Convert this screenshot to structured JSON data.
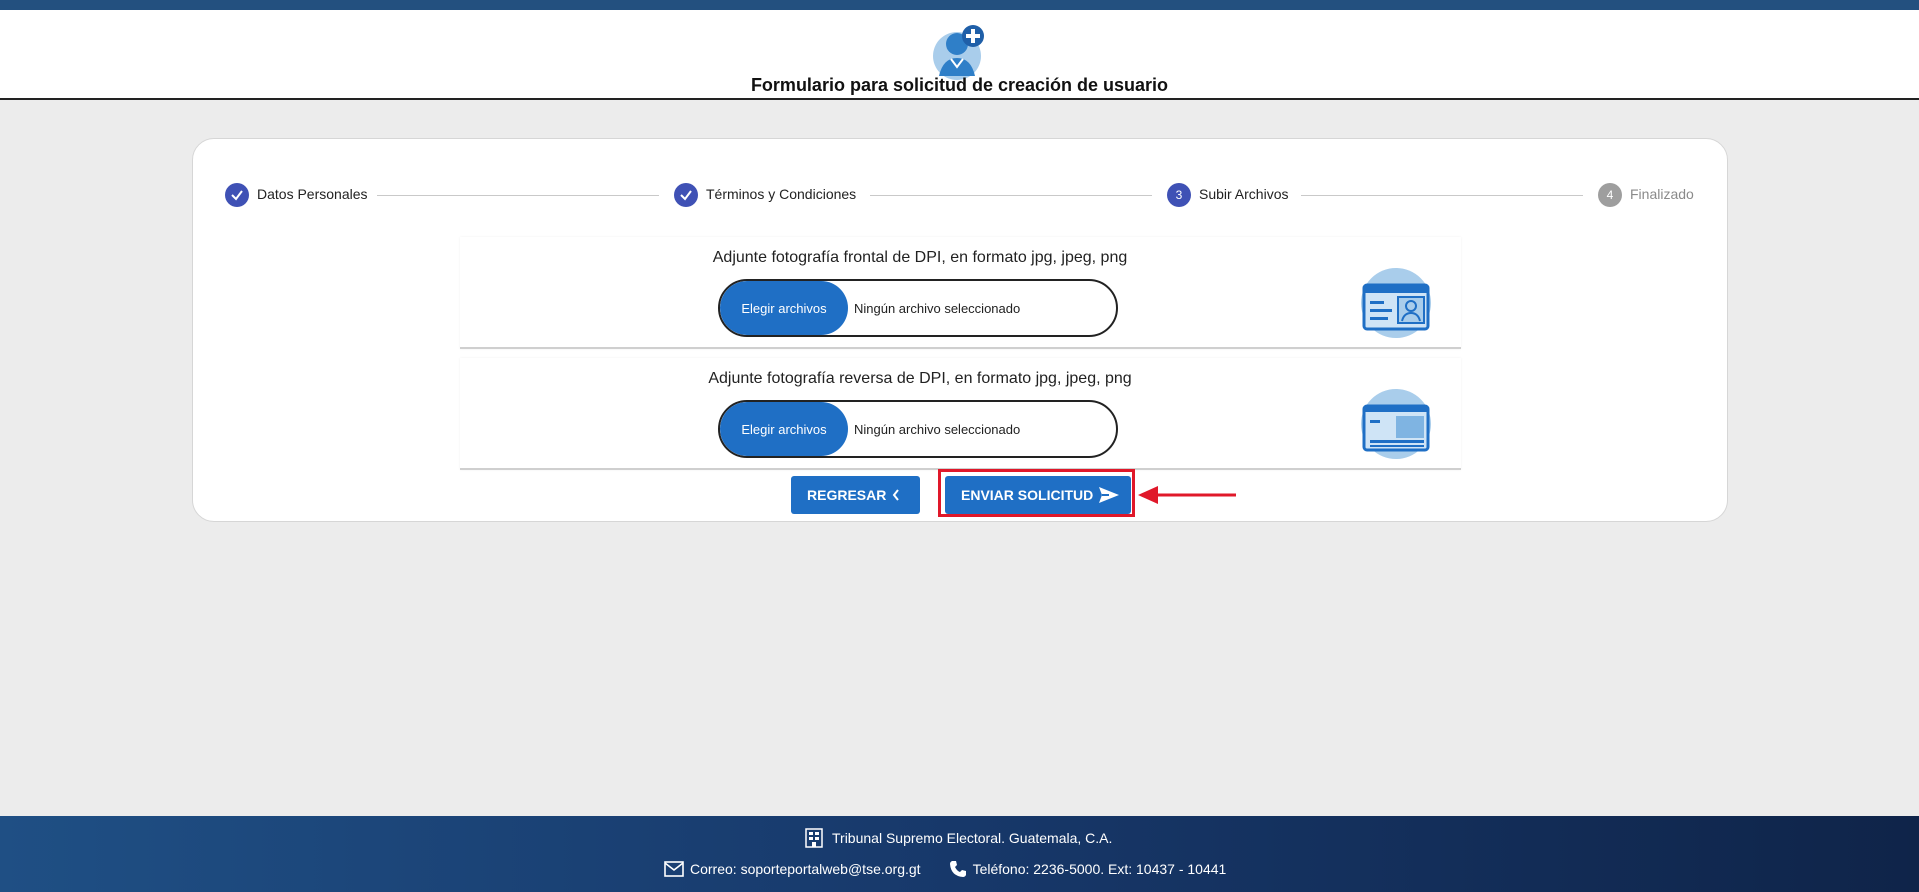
{
  "header": {
    "title": "Formulario para solicitud de creación de usuario",
    "icon": "user-add-icon"
  },
  "stepper": {
    "steps": [
      {
        "label": "Datos Personales",
        "state": "completed"
      },
      {
        "label": "Términos y Condiciones",
        "state": "completed"
      },
      {
        "number": "3",
        "label": "Subir Archivos",
        "state": "active"
      },
      {
        "number": "4",
        "label": "Finalizado",
        "state": "pending"
      }
    ]
  },
  "uploads": [
    {
      "title": "Adjunte fotografía frontal de DPI, en formato jpg, jpeg, png",
      "button_label": "Elegir archivos",
      "status": "Ningún archivo seleccionado",
      "icon": "id-card-front-icon"
    },
    {
      "title": "Adjunte fotografía reversa de DPI, en formato jpg, jpeg, png",
      "button_label": "Elegir archivos",
      "status": "Ningún archivo seleccionado",
      "icon": "id-card-back-icon"
    }
  ],
  "actions": {
    "back_label": "REGRESAR",
    "send_label": "ENVIAR SOLICITUD"
  },
  "annotation": {
    "highlight_color": "#e0182a"
  },
  "footer": {
    "org": "Tribunal Supremo Electoral. Guatemala, C.A.",
    "email": "Correo: soporteportalweb@tse.org.gt",
    "phone": "Teléfono: 2236-5000. Ext: 10437 - 10441"
  },
  "colors": {
    "primary": "#1f6fc5",
    "stepper_active": "#3f51b5",
    "stepper_pending": "#9e9e9e",
    "topbar": "#23507f"
  }
}
